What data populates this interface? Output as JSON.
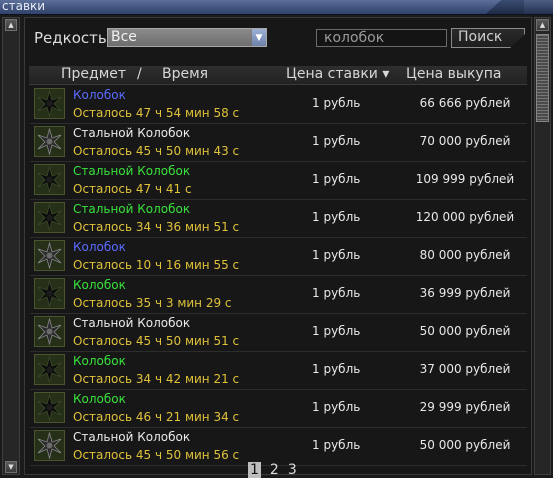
{
  "tab": {
    "label": "ставки"
  },
  "filter": {
    "rarity_label": "Редкость",
    "rarity_value": "Все",
    "search_value": "колобок",
    "search_button": "Поиск"
  },
  "columns": {
    "item": "Предмет",
    "separator": "/",
    "time": "Время",
    "bid_price": "Цена ставки ▾",
    "buyout_price": "Цена выкупа"
  },
  "rows": [
    {
      "name": "Колобок",
      "rarity_color": "#5a6cff",
      "time": "Осталось 47 ч 54 мин 58 с",
      "bid": "1 рубль",
      "buyout": "66 666 рублей",
      "icon": "dark-star-icon"
    },
    {
      "name": "Стальной Колобок",
      "rarity_color": "#eaeaea",
      "time": "Осталось 45 ч 50 мин 43 с",
      "bid": "1 рубль",
      "buyout": "70 000 рублей",
      "icon": "steel-star-icon"
    },
    {
      "name": "Стальной Колобок",
      "rarity_color": "#38e23a",
      "time": "Осталось 47 ч 41 с",
      "bid": "1 рубль",
      "buyout": "109 999 рублей",
      "icon": "dark-star-icon"
    },
    {
      "name": "Стальной Колобок",
      "rarity_color": "#38e23a",
      "time": "Осталось 34 ч 36 мин 51 с",
      "bid": "1 рубль",
      "buyout": "120 000 рублей",
      "icon": "dark-star-icon"
    },
    {
      "name": "Колобок",
      "rarity_color": "#5a6cff",
      "time": "Осталось 10 ч 16 мин 55 с",
      "bid": "1 рубль",
      "buyout": "80 000 рублей",
      "icon": "steel-star-icon"
    },
    {
      "name": "Колобок",
      "rarity_color": "#38e23a",
      "time": "Осталось 35 ч 3 мин 29 с",
      "bid": "1 рубль",
      "buyout": "36 999 рублей",
      "icon": "dark-star-icon"
    },
    {
      "name": "Стальной Колобок",
      "rarity_color": "#eaeaea",
      "time": "Осталось 45 ч 50 мин 51 с",
      "bid": "1 рубль",
      "buyout": "50 000 рублей",
      "icon": "steel-star-icon"
    },
    {
      "name": "Колобок",
      "rarity_color": "#38e23a",
      "time": "Осталось 34 ч 42 мин 21 с",
      "bid": "1 рубль",
      "buyout": "37 000 рублей",
      "icon": "dark-star-icon"
    },
    {
      "name": "Колобок",
      "rarity_color": "#38e23a",
      "time": "Осталось 46 ч 21 мин 34 с",
      "bid": "1 рубль",
      "buyout": "29 999 рублей",
      "icon": "dark-star-icon"
    },
    {
      "name": "Стальной Колобок",
      "rarity_color": "#eaeaea",
      "time": "Осталось 45 ч 50 мин 56 с",
      "bid": "1 рубль",
      "buyout": "50 000 рублей",
      "icon": "steel-star-icon"
    }
  ],
  "pagination": {
    "pages": [
      "1",
      "2",
      "3"
    ],
    "current": "1"
  },
  "colors": {
    "time_text": "#e0c23a",
    "accent_blue": "#5a6cff",
    "accent_green": "#38e23a"
  }
}
